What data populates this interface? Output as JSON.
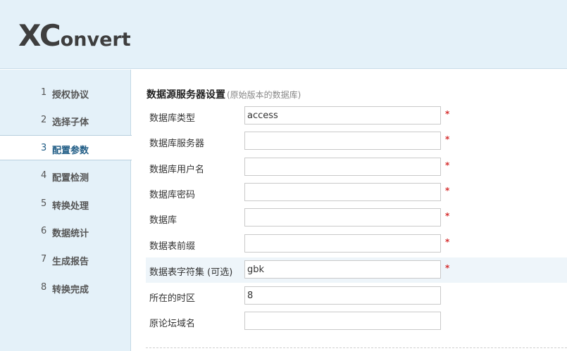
{
  "logo": {
    "first": "XC",
    "rest": "onvert"
  },
  "sidebar": {
    "items": [
      {
        "num": "1",
        "label": "授权协议"
      },
      {
        "num": "2",
        "label": "选择子体"
      },
      {
        "num": "3",
        "label": "配置参数"
      },
      {
        "num": "4",
        "label": "配置检测"
      },
      {
        "num": "5",
        "label": "转换处理"
      },
      {
        "num": "6",
        "label": "数据统计"
      },
      {
        "num": "7",
        "label": "生成报告"
      },
      {
        "num": "8",
        "label": "转换完成"
      }
    ],
    "active_index": 2
  },
  "form": {
    "title": "数据源服务器设置",
    "subtitle": "(原始版本的数据库)",
    "required_mark": "*",
    "fields": [
      {
        "label": "数据库类型",
        "value": "access",
        "required": true
      },
      {
        "label": "数据库服务器",
        "value": "",
        "required": true
      },
      {
        "label": "数据库用户名",
        "value": "",
        "required": true
      },
      {
        "label": "数据库密码",
        "value": "",
        "required": true
      },
      {
        "label": "数据库",
        "value": "",
        "required": true
      },
      {
        "label": "数据表前缀",
        "value": "",
        "required": true
      },
      {
        "label": "数据表字符集 (可选)",
        "value": "gbk",
        "required": true
      },
      {
        "label": "所在的时区",
        "value": "8",
        "required": false
      },
      {
        "label": "原论坛域名",
        "value": "",
        "required": false
      }
    ]
  },
  "colors": {
    "header_bg": "#e4f1f9",
    "active_text": "#1f5c85",
    "required": "#d63030"
  }
}
